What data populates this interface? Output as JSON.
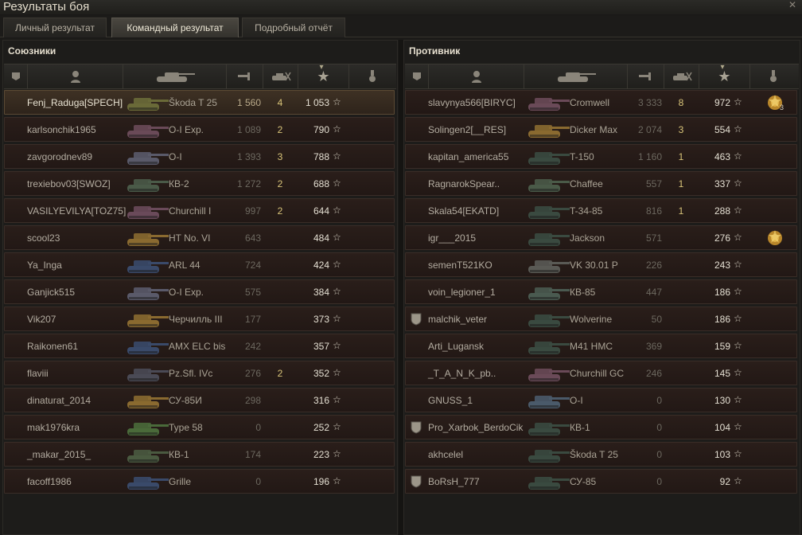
{
  "window": {
    "title": "Результаты боя",
    "close_icon": "close-icon"
  },
  "tabs": [
    {
      "label": "Личный результат",
      "active": false
    },
    {
      "label": "Командный результат",
      "active": true
    },
    {
      "label": "Подробный отчёт",
      "active": false
    }
  ],
  "columns": {
    "icons": [
      "platoon-icon",
      "player-icon",
      "tank-icon",
      "xp-icon",
      "kills-icon",
      "damage-star-icon",
      "medal-icon"
    ],
    "sorted_column": "damage-star-icon"
  },
  "allies": {
    "title": "Союзники",
    "rows": [
      {
        "name": "Fenj_Raduga[SPECH]",
        "tank": "Škoda T 25",
        "xp": "1 560",
        "kills": "4",
        "damage": "1 053",
        "me": true,
        "tank_color": "#6a6a38"
      },
      {
        "name": "karlsonchik1965",
        "tank": "O-I Exp.",
        "xp": "1 089",
        "kills": "2",
        "damage": "790",
        "tank_color": "#6a4a58"
      },
      {
        "name": "zavgorodnev89",
        "tank": "O-I",
        "xp": "1 393",
        "kills": "3",
        "damage": "788",
        "tank_color": "#5a5a6a"
      },
      {
        "name": "trexiebov03[SWOZ]",
        "tank": "КВ-2",
        "xp": "1 272",
        "kills": "2",
        "damage": "688",
        "tank_color": "#4a5a48"
      },
      {
        "name": "VASILYEVILYA[TOZ75]",
        "tank": "Churchill I",
        "xp": "997",
        "kills": "2",
        "damage": "644",
        "tank_color": "#6a4a5a"
      },
      {
        "name": "scool23",
        "tank": "HT No. VI",
        "xp": "643",
        "kills": "",
        "damage": "484",
        "tank_color": "#8a6a30"
      },
      {
        "name": "Ya_Inga",
        "tank": "ARL 44",
        "xp": "724",
        "kills": "",
        "damage": "424",
        "tank_color": "#3a4a6a"
      },
      {
        "name": "Ganjick515",
        "tank": "O-I Exp.",
        "xp": "575",
        "kills": "",
        "damage": "384",
        "tank_color": "#5a5a6a"
      },
      {
        "name": "Vik207",
        "tank": "Черчилль III",
        "xp": "177",
        "kills": "",
        "damage": "373",
        "tank_color": "#8a6a30"
      },
      {
        "name": "Raikonen61",
        "tank": "AMX ELC bis",
        "xp": "242",
        "kills": "",
        "damage": "357",
        "tank_color": "#3a4a6a"
      },
      {
        "name": "flaviii",
        "tank": "Pz.Sfl. IVc",
        "xp": "276",
        "kills": "2",
        "damage": "352",
        "tank_color": "#4a4a55"
      },
      {
        "name": "dinaturat_2014",
        "tank": "СУ-85И",
        "xp": "298",
        "kills": "",
        "damage": "316",
        "tank_color": "#8a6a30"
      },
      {
        "name": "mak1976kra",
        "tank": "Type 58",
        "xp": "0",
        "kills": "",
        "damage": "252",
        "tank_color": "#4a6a3a"
      },
      {
        "name": "_makar_2015_",
        "tank": "КВ-1",
        "xp": "174",
        "kills": "",
        "damage": "223",
        "tank_color": "#4a5a40"
      },
      {
        "name": "facoff1986",
        "tank": "Grille",
        "xp": "0",
        "kills": "",
        "damage": "196",
        "tank_color": "#3a4a6a"
      }
    ]
  },
  "enemies": {
    "title": "Противник",
    "rows": [
      {
        "name": "slavynya566[BIRYC]",
        "tank": "Cromwell",
        "xp": "3 333",
        "kills": "8",
        "damage": "972",
        "medal": "medal-icon",
        "medal_count": "3",
        "tank_color": "#6a4a58"
      },
      {
        "name": "Solingen2[__RES]",
        "tank": "Dicker Max",
        "xp": "2 074",
        "kills": "3",
        "damage": "554",
        "tank_color": "#8a6a30"
      },
      {
        "name": "kapitan_america55",
        "tank": "T-150",
        "xp": "1 160",
        "kills": "1",
        "damage": "463",
        "tank_color": "#3a4a40"
      },
      {
        "name": "RagnarokSpear..",
        "tank": "Chaffee",
        "xp": "557",
        "kills": "1",
        "damage": "337",
        "tank_color": "#4a5a48"
      },
      {
        "name": "Skala54[EKATD]",
        "tank": "T-34-85",
        "xp": "816",
        "kills": "1",
        "damage": "288",
        "tank_color": "#3a4a40"
      },
      {
        "name": "igr___2015",
        "tank": "Jackson",
        "xp": "571",
        "kills": "",
        "damage": "276",
        "medal": "medal-icon",
        "tank_color": "#3a4a40"
      },
      {
        "name": "semenT521KO",
        "tank": "VK 30.01 P",
        "xp": "226",
        "kills": "",
        "damage": "243",
        "tank_color": "#5a5a55"
      },
      {
        "name": "voin_legioner_1",
        "tank": "КВ-85",
        "xp": "447",
        "kills": "",
        "damage": "186",
        "tank_color": "#4a5a50"
      },
      {
        "name": "malchik_veter",
        "tank": "Wolverine",
        "xp": "50",
        "kills": "",
        "damage": "186",
        "badge": "shield-icon",
        "tank_color": "#3a4a40"
      },
      {
        "name": "Arti_Lugansk",
        "tank": "M41 HMC",
        "xp": "369",
        "kills": "",
        "damage": "159",
        "tank_color": "#3a4a40"
      },
      {
        "name": "_T_A_N_K_pb..",
        "tank": "Churchill GC",
        "xp": "246",
        "kills": "",
        "damage": "145",
        "tank_color": "#6a4a58"
      },
      {
        "name": "GNUSS_1",
        "tank": "O-I",
        "xp": "0",
        "kills": "",
        "damage": "130",
        "tank_color": "#4a5a6a"
      },
      {
        "name": "Pro_Xarbok_BerdoCik",
        "tank": "КВ-1",
        "xp": "0",
        "kills": "",
        "damage": "104",
        "badge": "shield-icon",
        "tank_color": "#3a4a40"
      },
      {
        "name": "akhcelel",
        "tank": "Škoda T 25",
        "xp": "0",
        "kills": "",
        "damage": "103",
        "tank_color": "#3a4a40"
      },
      {
        "name": "BoRsH_777",
        "tank": "СУ-85",
        "xp": "0",
        "kills": "",
        "damage": "92",
        "badge": "shield-icon",
        "tank_color": "#3a4a40"
      }
    ]
  }
}
